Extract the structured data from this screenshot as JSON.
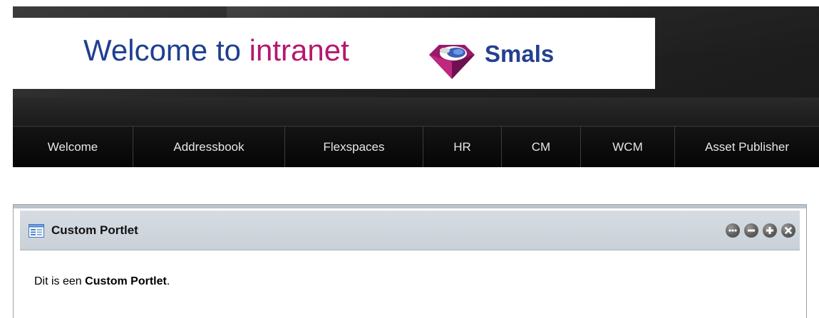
{
  "header": {
    "welcome_prefix": "Welcome to",
    "welcome_accent": "intranet",
    "brand_name": "Smals"
  },
  "nav": {
    "items": [
      {
        "label": "Welcome"
      },
      {
        "label": "Addressbook"
      },
      {
        "label": "Flexspaces"
      },
      {
        "label": "HR"
      },
      {
        "label": "CM"
      },
      {
        "label": "WCM"
      },
      {
        "label": "Asset Publisher"
      }
    ]
  },
  "portlet": {
    "title": "Custom Portlet",
    "title_icon": "portlet-window-icon",
    "controls": [
      {
        "icon": "options-icon"
      },
      {
        "icon": "minimize-icon"
      },
      {
        "icon": "maximize-icon"
      },
      {
        "icon": "close-icon"
      }
    ],
    "content_prefix": "Dit is een ",
    "content_bold": "Custom Portlet",
    "content_suffix": "."
  },
  "colors": {
    "welcome_text": "#1f3f8f",
    "intranet_accent": "#b5176f",
    "brand_text": "#24408f",
    "nav_bg": "#0a0a0a",
    "portlet_header_bg": "#d0d6dc"
  }
}
